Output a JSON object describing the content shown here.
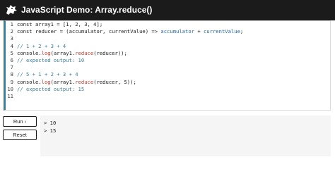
{
  "header": {
    "title": "JavaScript Demo: Array.reduce()"
  },
  "editor": {
    "line_numbers": [
      "1",
      "2",
      "3",
      "4",
      "5",
      "6",
      "7",
      "8",
      "9",
      "10",
      "11"
    ]
  },
  "controls": {
    "run_label": "Run ›",
    "reset_label": "Reset"
  },
  "output": {
    "lines": [
      "> 10",
      "> 15"
    ]
  },
  "colors": {
    "header_bg": "#1b1b1b",
    "editor_accent": "#3d7e9a",
    "function_call": "#c0392b",
    "property": "#1a66a8",
    "comment": "#3d7e9a",
    "output_bg": "#f5f5f5"
  },
  "icons": {
    "logo": "dinosaur-head-logo"
  }
}
